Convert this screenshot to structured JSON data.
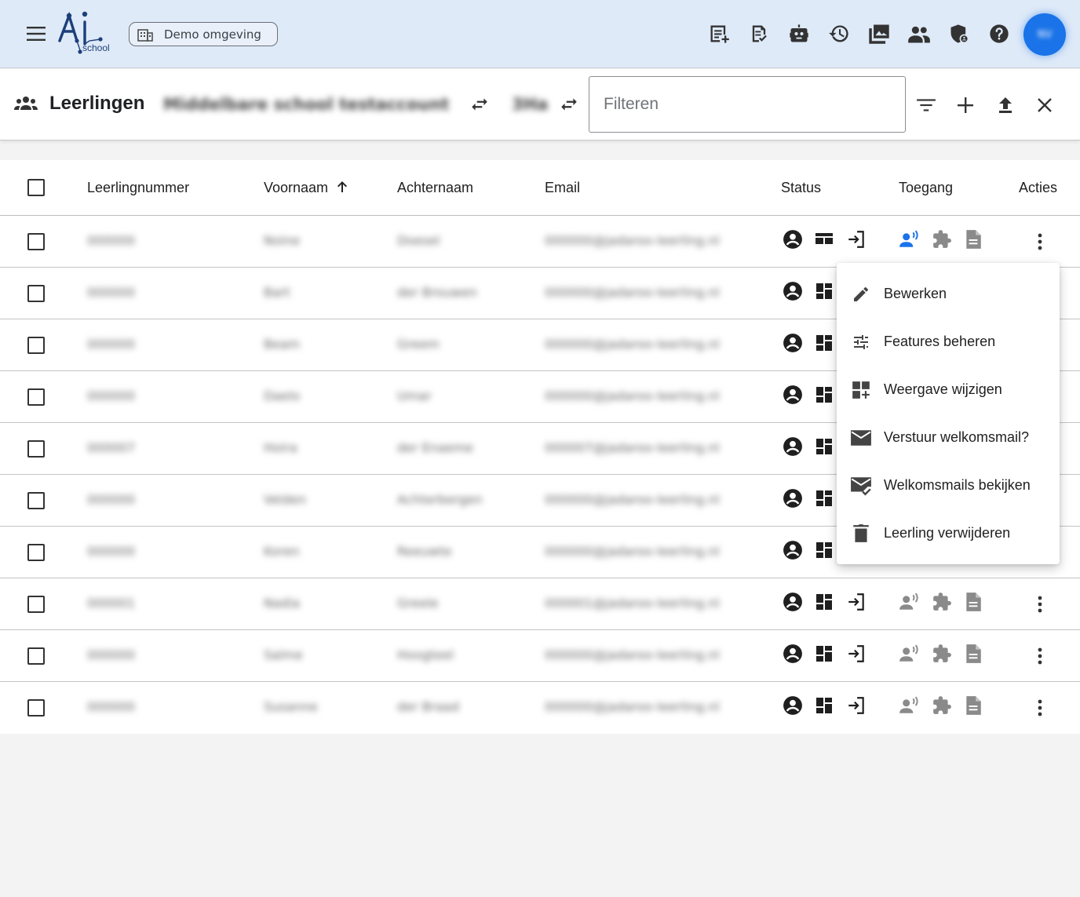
{
  "app": {
    "logo_text": "AI",
    "logo_subtext": "school",
    "environment_chip": "Demo omgeving",
    "avatar_initials": "NV"
  },
  "top_icons": [
    "add-report-icon",
    "assignment-icon",
    "robot-icon",
    "history-icon",
    "photo-library-icon",
    "group-icon",
    "admin-shield-icon",
    "help-icon"
  ],
  "toolbar": {
    "title": "Leerlingen",
    "school_name": "Middelbare school testaccount",
    "class_name": "3Ha",
    "filter_placeholder": "Filteren"
  },
  "table": {
    "columns": {
      "student_number": "Leerlingnummer",
      "first_name": "Voornaam",
      "last_name": "Achternaam",
      "email": "Email",
      "status": "Status",
      "access": "Toegang",
      "actions": "Acties"
    },
    "rows": [
      {
        "number": "000000",
        "first": "Noine",
        "last": "Doesel",
        "email": "000000@jadaroo-leerling.nl"
      },
      {
        "number": "000000",
        "first": "Bart",
        "last": "der Brouwen",
        "email": "000000@jadaroo-leerling.nl"
      },
      {
        "number": "000000",
        "first": "Beam",
        "last": "Greem",
        "email": "000000@jadaroo-leerling.nl"
      },
      {
        "number": "000000",
        "first": "Daelo",
        "last": "Umar",
        "email": "000000@jadaroo-leerling.nl"
      },
      {
        "number": "000007",
        "first": "Hoira",
        "last": "der Enaeme",
        "email": "000007@jadaroo-leerling.nl"
      },
      {
        "number": "000000",
        "first": "Velden",
        "last": "Achterbergen",
        "email": "000000@jadaroo-leerling.nl"
      },
      {
        "number": "000000",
        "first": "Koren",
        "last": "Reeuwte",
        "email": "000000@jadaroo-leerling.nl"
      },
      {
        "number": "000001",
        "first": "Nadia",
        "last": "Greele",
        "email": "000001@jadaroo-leerling.nl"
      },
      {
        "number": "000000",
        "first": "Salme",
        "last": "Hoogteel",
        "email": "000000@jadaroo-leerling.nl"
      },
      {
        "number": "000000",
        "first": "Susanne",
        "last": "der Braad",
        "email": "000000@jadaroo-leerling.nl"
      }
    ]
  },
  "context_menu": {
    "items": [
      {
        "label": "Bewerken",
        "icon": "edit-icon"
      },
      {
        "label": "Features beheren",
        "icon": "tune-icon"
      },
      {
        "label": "Weergave wijzigen",
        "icon": "dashboard-customize-icon"
      },
      {
        "label": "Verstuur welkomsmail?",
        "icon": "mail-icon"
      },
      {
        "label": "Welkomsmails bekijken",
        "icon": "mark-email-read-icon"
      },
      {
        "label": "Leerling verwijderen",
        "icon": "delete-icon"
      }
    ]
  },
  "colors": {
    "topbar_bg": "#dfeaf8",
    "accent_blue": "#1a73e8",
    "icon_dark": "#1f1f1f",
    "icon_gray": "#8a8a8a"
  }
}
